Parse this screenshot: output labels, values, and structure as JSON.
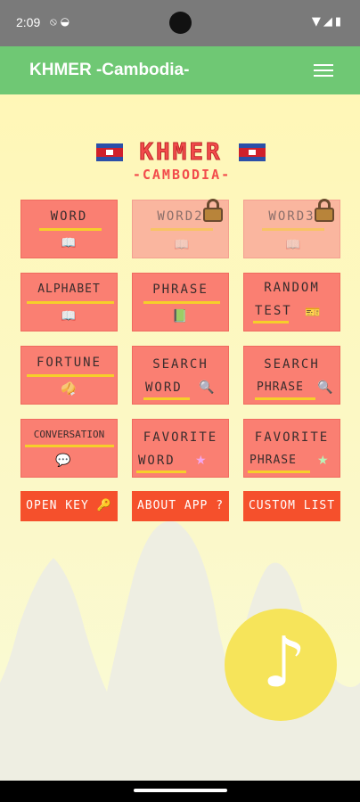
{
  "status_bar": {
    "time": "2:09"
  },
  "app_bar": {
    "title": "KHMER -Cambodia-"
  },
  "logo": {
    "main": "KHMER",
    "sub": "-CAMBODIA-"
  },
  "tiles": {
    "word": {
      "line1": "WORD"
    },
    "word2": {
      "line1": "WORD2"
    },
    "word3": {
      "line1": "WORD3"
    },
    "alphabet": {
      "line1": "ALPHABET"
    },
    "phrase": {
      "line1": "PHRASE"
    },
    "random_test": {
      "line1": "RANDOM",
      "line2": "TEST"
    },
    "fortune": {
      "line1": "FORTUNE"
    },
    "search_word": {
      "line1": "SEARCH",
      "line2": "WORD"
    },
    "search_phrase": {
      "line1": "SEARCH",
      "line2": "PHRASE"
    },
    "conversation": {
      "line1": "CONVERSATION"
    },
    "favorite_word": {
      "line1": "FAVORITE",
      "line2": "WORD"
    },
    "favorite_phrase": {
      "line1": "FAVORITE",
      "line2": "PHRASE"
    }
  },
  "buttons": {
    "open_key": "OPEN KEY",
    "about_app": "ABOUT APP",
    "custom_list": "CUSTOM LIST"
  },
  "icons": {
    "book": "book-icon",
    "lock": "lock-icon",
    "music": "music-note-icon"
  },
  "colors": {
    "app_bar": "#6fc874",
    "tile": "#fa7f72",
    "tile_locked": "#fab69f",
    "bottom_button": "#f5502c",
    "music_button": "#f6e45a",
    "logo_text": "#f24c4c"
  }
}
